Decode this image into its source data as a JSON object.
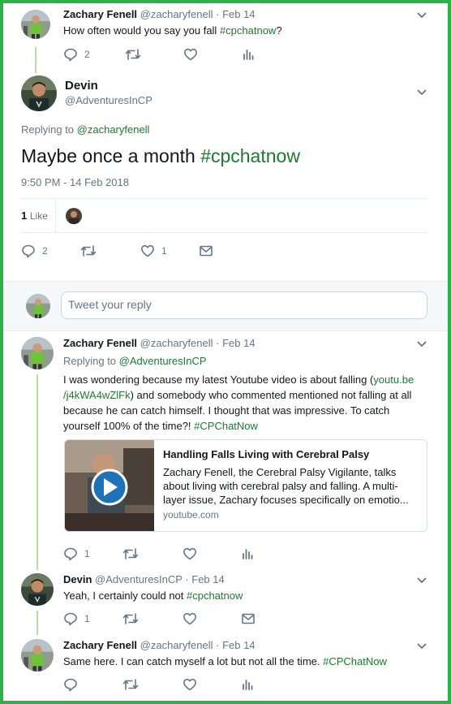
{
  "tweet1": {
    "name": "Zachary Fenell",
    "handle": "@zacharyfenell",
    "dot": "·",
    "date": "Feb 14",
    "text_plain": "How often would you say you fall ",
    "hashtag": "#cpchatnow",
    "text_end": "?",
    "reply_count": "2"
  },
  "main": {
    "name": "Devin",
    "handle": "@AdventuresInCP",
    "replying_label": "Replying to ",
    "replying_to": "@zacharyfenell",
    "text_plain": "Maybe once a month ",
    "hashtag": "#cpchatnow",
    "timestamp": "9:50 PM - 14 Feb 2018",
    "likes_count": "1",
    "likes_label": "Like",
    "reply_count": "2",
    "like_count": "1"
  },
  "reply_box": {
    "placeholder": "Tweet your reply"
  },
  "tweet3": {
    "name": "Zachary Fenell",
    "handle": "@zacharyfenell",
    "dot": "·",
    "date": "Feb 14",
    "replying_label": "Replying to ",
    "replying_to": "@AdventuresInCP",
    "line1a": "I was wondering because my latest Youtube video is about falling (",
    "line1link": "youtu.be",
    "line2link": "/j4kWA4wZlFk",
    "line2b": ") and somebody who commented mentioned not falling at all",
    "line3": "because he can catch himself. I thought that was impressive. To catch",
    "line4a": "yourself 100% of the time?! ",
    "hashtag": "#CPChatNow",
    "reply_count": "1"
  },
  "card": {
    "title": "Handling Falls Living with Cerebral Palsy",
    "desc_line1": "Zachary Fenell, the Cerebral Palsy Vigilante, talks",
    "desc_line2": "about living with cerebral palsy and falling. A multi-",
    "desc_line3": "layer issue, Zachary focuses specifically on emotio...",
    "domain": "youtube.com"
  },
  "tweet4": {
    "name": "Devin",
    "handle": "@AdventuresInCP",
    "dot": "·",
    "date": "Feb 14",
    "text_plain": "Yeah, I certainly could not ",
    "hashtag": "#cpchatnow",
    "reply_count": "1"
  },
  "tweet5": {
    "name": "Zachary Fenell",
    "handle": "@zacharyfenell",
    "dot": "·",
    "date": "Feb 14",
    "text_plain": "Same here. I can catch myself a lot but not all the time. ",
    "hashtag": "#CPChatNow"
  },
  "colors": {
    "frame": "#2db14a",
    "link": "#1d7b2f",
    "muted": "#657786",
    "thread_line": "#b9dfa8",
    "play_button": "#1e72b8"
  },
  "icons": [
    "reply-icon",
    "retweet-icon",
    "like-icon",
    "analytics-icon",
    "message-icon",
    "chevron-down-icon",
    "play-icon"
  ]
}
